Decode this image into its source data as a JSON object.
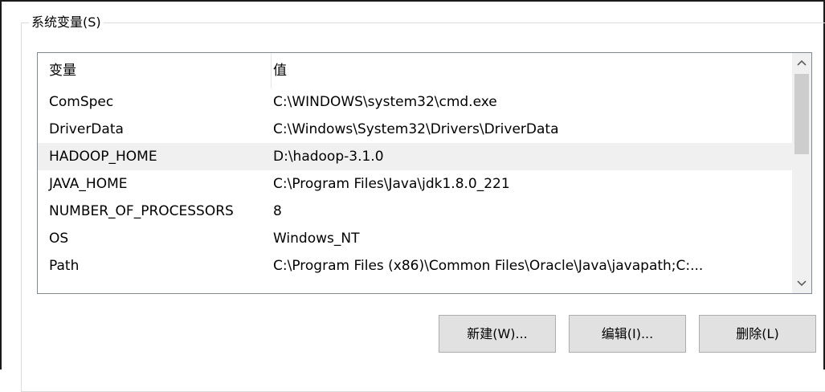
{
  "group": {
    "title": "系统变量(S)"
  },
  "list": {
    "columns": [
      "变量",
      "值"
    ],
    "rows": [
      {
        "name": "ComSpec",
        "value": "C:\\WINDOWS\\system32\\cmd.exe",
        "selected": false
      },
      {
        "name": "DriverData",
        "value": "C:\\Windows\\System32\\Drivers\\DriverData",
        "selected": false
      },
      {
        "name": "HADOOP_HOME",
        "value": "D:\\hadoop-3.1.0",
        "selected": true
      },
      {
        "name": "JAVA_HOME",
        "value": "C:\\Program Files\\Java\\jdk1.8.0_221",
        "selected": false
      },
      {
        "name": "NUMBER_OF_PROCESSORS",
        "value": "8",
        "selected": false
      },
      {
        "name": "OS",
        "value": "Windows_NT",
        "selected": false
      },
      {
        "name": "Path",
        "value": "C:\\Program Files (x86)\\Common Files\\Oracle\\Java\\javapath;C:...",
        "selected": false
      }
    ]
  },
  "scrollbar": {
    "up_icon": "chevron-up-icon",
    "down_icon": "chevron-down-icon"
  },
  "buttons": {
    "new_label": "新建(W)...",
    "edit_label": "编辑(I)...",
    "delete_label": "删除(L)"
  },
  "colors": {
    "selected_row": "#f0f0f0",
    "button_bg": "#e1e1e1",
    "button_border": "#adadad"
  }
}
